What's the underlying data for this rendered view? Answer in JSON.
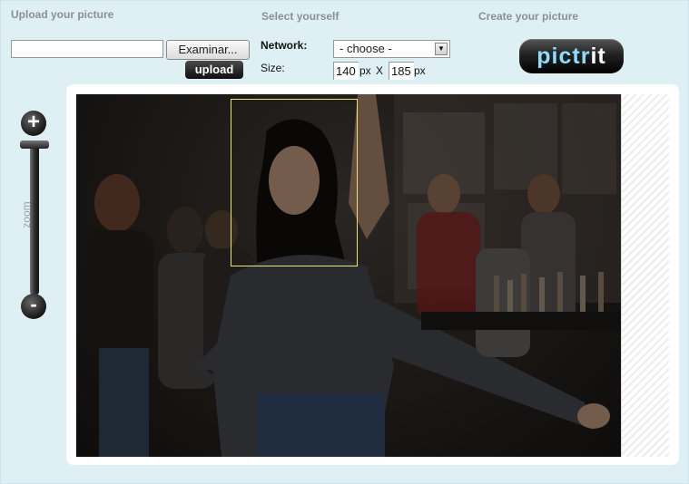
{
  "sections": {
    "upload_title": "Upload your picture",
    "select_title": "Select yourself",
    "create_title": "Create your picture"
  },
  "upload": {
    "file_value": "",
    "browse_label": "Examinar...",
    "upload_label": "upload"
  },
  "select": {
    "network_label": "Network:",
    "network_selected": "- choose -",
    "size_label": "Size:",
    "width_value": "140",
    "height_value": "185",
    "unit": "px",
    "separator": "X"
  },
  "logo": {
    "part1": "pictr",
    "part2": "it",
    "color_part1": "#8fdcff",
    "color_part2": "#ffffff"
  },
  "zoom": {
    "label": "zoom",
    "plus": "+",
    "minus": "-"
  },
  "colors": {
    "background": "#dff0f5",
    "face_box": "#e6e67a"
  }
}
